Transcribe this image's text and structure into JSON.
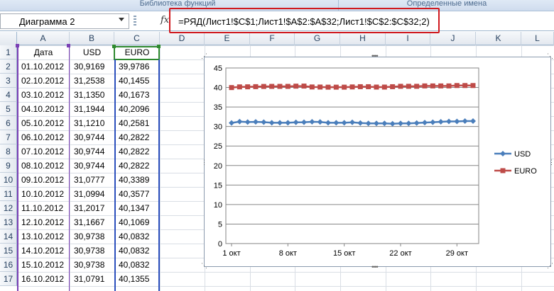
{
  "ribbon": {
    "group_left": "Библиотека функций",
    "group_right": "Определенные имена"
  },
  "formula_bar": {
    "name_box": "Диаграмма 2",
    "fx_icon": "fx",
    "formula": "=РЯД(Лист1!$C$1;Лист1!$A$2:$A$32;Лист1!$C$2:$C$32;2)"
  },
  "columns": [
    "A",
    "B",
    "C",
    "D",
    "E",
    "F",
    "G",
    "H",
    "I",
    "J",
    "K",
    "L"
  ],
  "rows": [
    "1",
    "2",
    "3",
    "4",
    "5",
    "6",
    "7",
    "8",
    "9",
    "10",
    "11",
    "12",
    "13",
    "14",
    "15",
    "16",
    "17"
  ],
  "headers": {
    "a": "Дата",
    "b": "USD",
    "c": "EURO"
  },
  "table": [
    [
      "01.10.2012",
      "30,9169",
      "39,9786"
    ],
    [
      "02.10.2012",
      "31,2538",
      "40,1455"
    ],
    [
      "03.10.2012",
      "31,1350",
      "40,1673"
    ],
    [
      "04.10.2012",
      "31,1944",
      "40,2096"
    ],
    [
      "05.10.2012",
      "31,1210",
      "40,2581"
    ],
    [
      "06.10.2012",
      "30,9744",
      "40,2822"
    ],
    [
      "07.10.2012",
      "30,9744",
      "40,2822"
    ],
    [
      "08.10.2012",
      "30,9744",
      "40,2822"
    ],
    [
      "09.10.2012",
      "31,0777",
      "40,3389"
    ],
    [
      "10.10.2012",
      "31,0994",
      "40,3577"
    ],
    [
      "11.10.2012",
      "31,2017",
      "40,1347"
    ],
    [
      "12.10.2012",
      "31,1667",
      "40,1069"
    ],
    [
      "13.10.2012",
      "30,9738",
      "40,0832"
    ],
    [
      "14.10.2012",
      "30,9738",
      "40,0832"
    ],
    [
      "15.10.2012",
      "30,9738",
      "40,0832"
    ],
    [
      "16.10.2012",
      "31,0791",
      "40,1355"
    ]
  ],
  "chart_data": {
    "type": "line",
    "x_tick_labels": [
      "1 окт",
      "8 окт",
      "15 окт",
      "22 окт",
      "29 окт"
    ],
    "ylim": [
      0,
      45
    ],
    "y_ticks": [
      0,
      5,
      10,
      15,
      20,
      25,
      30,
      35,
      40,
      45
    ],
    "grid": true,
    "legend": "right",
    "series": [
      {
        "name": "USD",
        "color": "#4a7ebb",
        "marker": "diamond",
        "values": [
          30.92,
          31.25,
          31.14,
          31.19,
          31.12,
          30.97,
          30.97,
          30.97,
          31.08,
          31.1,
          31.2,
          31.17,
          30.97,
          30.97,
          30.97,
          31.08,
          30.9,
          30.8,
          30.8,
          30.8,
          30.7,
          30.8,
          30.8,
          30.9,
          31.0,
          31.1,
          31.2,
          31.3,
          31.3,
          31.4,
          31.4
        ]
      },
      {
        "name": "EURO",
        "color": "#be4b48",
        "marker": "square",
        "values": [
          39.98,
          40.15,
          40.17,
          40.21,
          40.26,
          40.28,
          40.28,
          40.28,
          40.34,
          40.36,
          40.13,
          40.11,
          40.08,
          40.08,
          40.08,
          40.14,
          40.2,
          40.2,
          40.1,
          40.1,
          40.2,
          40.3,
          40.3,
          40.3,
          40.4,
          40.4,
          40.4,
          40.4,
          40.5,
          40.5,
          40.5
        ]
      }
    ]
  }
}
